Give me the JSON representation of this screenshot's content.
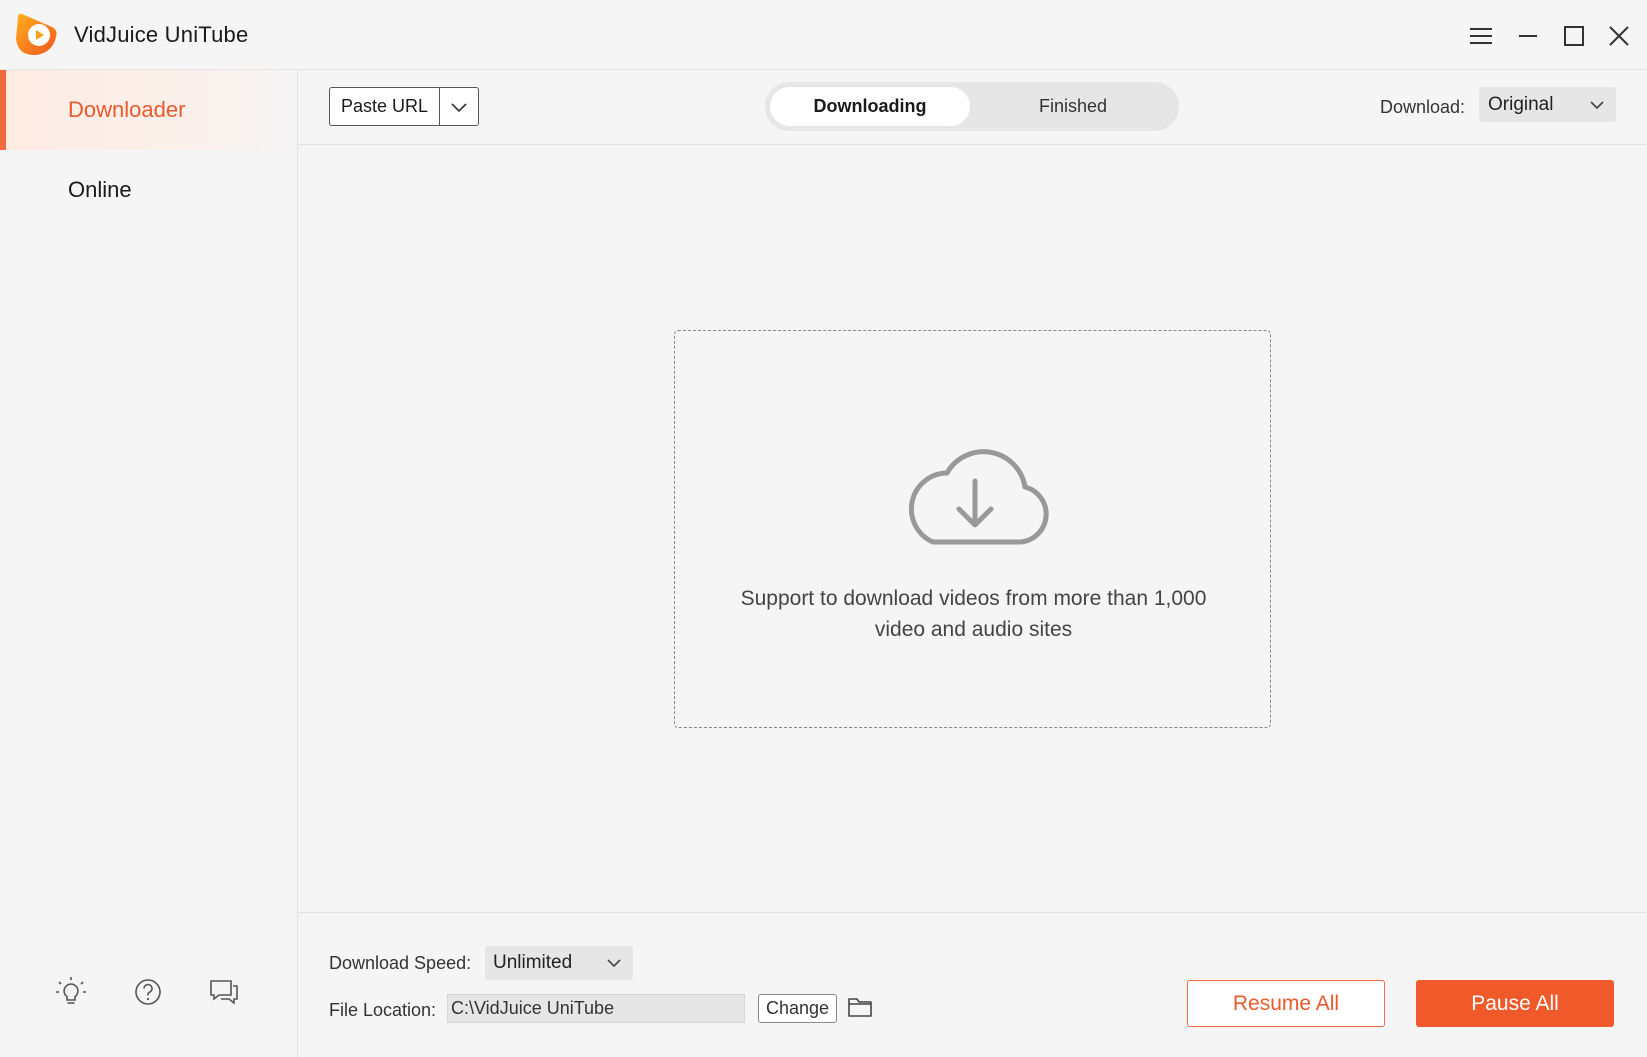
{
  "app": {
    "title": "VidJuice UniTube",
    "accent_color": "#f05a2a"
  },
  "window_controls": [
    "menu-icon",
    "minimize-icon",
    "maximize-icon",
    "close-icon"
  ],
  "sidebar": {
    "items": [
      {
        "label": "Downloader",
        "active": true
      },
      {
        "label": "Online",
        "active": false
      }
    ],
    "footer_icons": [
      "lightbulb-icon",
      "help-icon",
      "feedback-icon"
    ]
  },
  "toolbar": {
    "paste_label": "Paste URL",
    "tabs": [
      {
        "label": "Downloading",
        "active": true
      },
      {
        "label": "Finished",
        "active": false
      }
    ],
    "download_label": "Download:",
    "download_value": "Original"
  },
  "dropzone": {
    "text_line1": "Support to download videos from more than 1,000",
    "text_line2": "video and audio sites"
  },
  "bottom": {
    "speed_label": "Download Speed:",
    "speed_value": "Unlimited",
    "location_label": "File Location:",
    "location_value": "C:\\VidJuice UniTube",
    "change_label": "Change",
    "resume_label": "Resume All",
    "pause_label": "Pause All"
  }
}
